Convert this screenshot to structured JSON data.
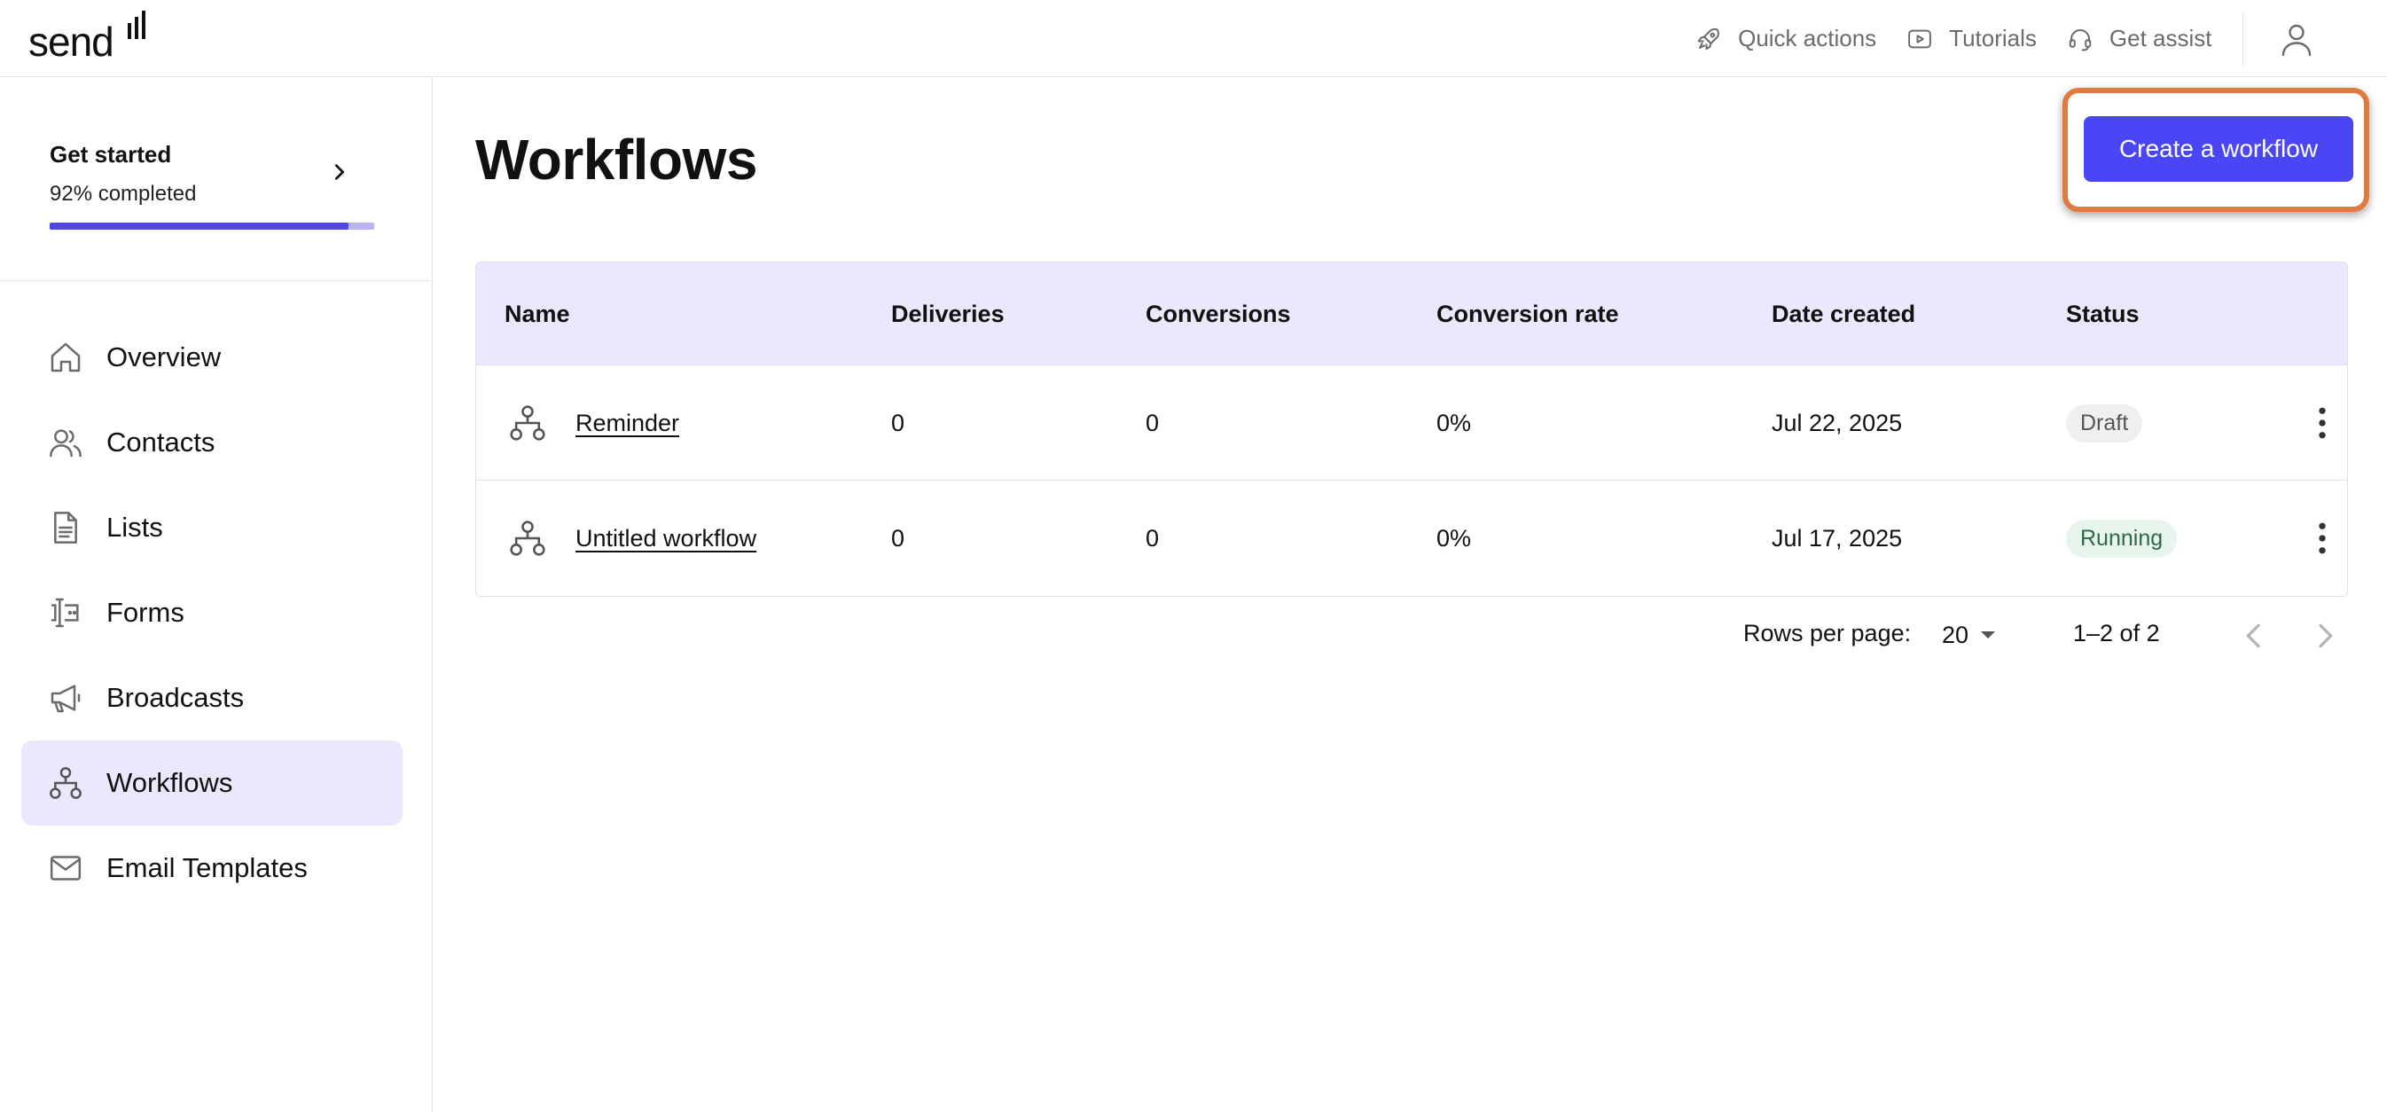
{
  "app": {
    "logo_text": "send"
  },
  "topbar": {
    "actions": [
      {
        "label": "Quick actions",
        "icon": "rocket-icon"
      },
      {
        "label": "Tutorials",
        "icon": "play-icon"
      },
      {
        "label": "Get assist",
        "icon": "headset-icon"
      }
    ],
    "avatar_icon": "user-icon"
  },
  "sidebar": {
    "get_started": {
      "title": "Get started",
      "progress_text": "92% completed",
      "progress": 0.92
    },
    "items": [
      {
        "label": "Overview",
        "icon": "home-icon",
        "active": false
      },
      {
        "label": "Contacts",
        "icon": "users-icon",
        "active": false
      },
      {
        "label": "Lists",
        "icon": "document-icon",
        "active": false
      },
      {
        "label": "Forms",
        "icon": "form-icon",
        "active": false
      },
      {
        "label": "Broadcasts",
        "icon": "megaphone-icon",
        "active": false
      },
      {
        "label": "Workflows",
        "icon": "workflow-icon",
        "active": true
      },
      {
        "label": "Email Templates",
        "icon": "mail-icon",
        "active": false
      }
    ]
  },
  "main": {
    "title": "Workflows",
    "create_button": "Create a workflow",
    "table": {
      "columns": [
        "Name",
        "Deliveries",
        "Conversions",
        "Conversion rate",
        "Date created",
        "Status"
      ],
      "rows": [
        {
          "name": "Reminder",
          "deliveries": "0",
          "conversions": "0",
          "conversion_rate": "0%",
          "date_created": "Jul 22, 2025",
          "status": "Draft"
        },
        {
          "name": "Untitled workflow",
          "deliveries": "0",
          "conversions": "0",
          "conversion_rate": "0%",
          "date_created": "Jul 17, 2025",
          "status": "Running"
        }
      ]
    },
    "pagination": {
      "rows_per_page_label": "Rows per page:",
      "rows_per_page_value": "20",
      "range_text": "1–2 of 2"
    }
  },
  "colors": {
    "accent": "#4a46f5",
    "highlight_outline": "#e07a3f",
    "header_bg": "#e9e8fc"
  }
}
